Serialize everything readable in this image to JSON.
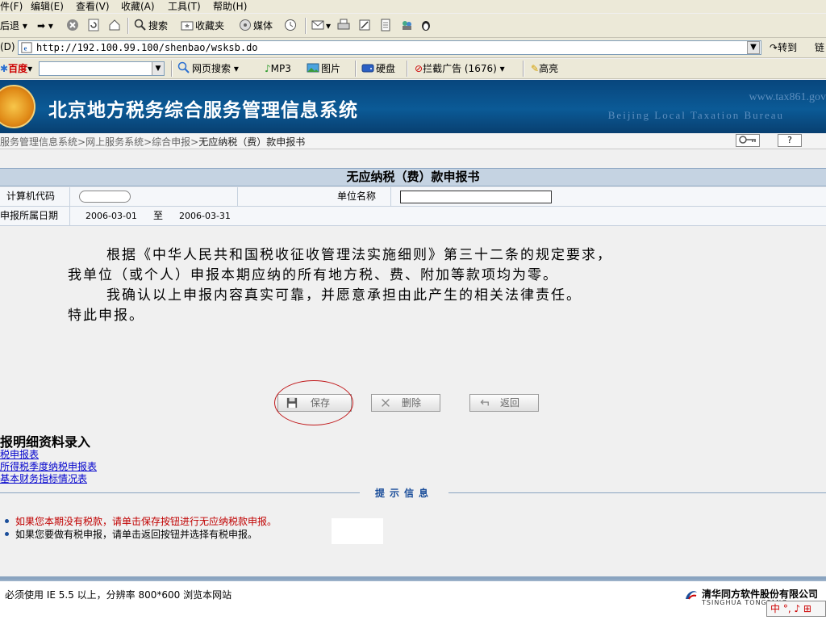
{
  "menu": [
    "件(F)",
    "编辑(E)",
    "查看(V)",
    "收藏(A)",
    "工具(T)",
    "帮助(H)"
  ],
  "toolbar": {
    "back": "后退",
    "search": "搜索",
    "favorites": "收藏夹",
    "media": "媒体"
  },
  "address": {
    "label": "(D)",
    "url": "http://192.100.99.100/shenbao/wsksb.do",
    "go": "转到",
    "links": "链"
  },
  "searchbar": {
    "engine": "百度",
    "web_search": "网页搜索",
    "mp3": "MP3",
    "image": "图片",
    "disk": "硬盘",
    "block_ads": "拦截广告 (1676)",
    "highlight": "高亮"
  },
  "header": {
    "title": "北京地方税务综合服务管理信息系统",
    "site_url": "www.tax861.gov",
    "site_en": "Beijing Local Taxation Bureau"
  },
  "breadcrumb": [
    "服务管理信息系统",
    "网上服务系统",
    "综合申报",
    "无应纳税（费）款申报书"
  ],
  "form": {
    "title": "无应纳税（费）款申报书",
    "computer_code_label": "计算机代码",
    "unit_name_label": "单位名称",
    "period_label": "申报所属日期",
    "period_start": "2006-03-01",
    "period_to": "至",
    "period_end": "2006-03-31"
  },
  "statement": [
    "根据《中华人民共和国税收征收管理法实施细则》第三十二条的规定要求，",
    "我单位（或个人）申报本期应纳的所有地方税、费、附加等款项均为零。",
    "我确认以上申报内容真实可靠，并愿意承担由此产生的相关法律责任。",
    "特此申报。"
  ],
  "buttons": {
    "save": "保存",
    "delete": "删除",
    "back": "返回"
  },
  "details": {
    "title": "报明细资料录入",
    "links": [
      "税申报表",
      "所得税季度纳税申报表",
      "基本财务指标情况表"
    ]
  },
  "tips": {
    "title": "提示信息",
    "items": [
      "如果您本期没有税款，请单击保存按钮进行无应纳税款申报。",
      "如果您要做有税申报，请单击返回按钮并选择有税申报。"
    ]
  },
  "footer": {
    "text": "必须使用 IE 5.5 以上，分辨率 800*600 浏览本网站",
    "company": "清华同方软件股份有限公司",
    "company_en": "TSINGHUA TONGFANG",
    "ime": "中 °, ♪ ⊞"
  },
  "colors": {
    "header_blue": "#0b5a96",
    "tip_red": "#c00000",
    "link_blue": "#0000cc",
    "highlight_red": "#c0181a"
  }
}
